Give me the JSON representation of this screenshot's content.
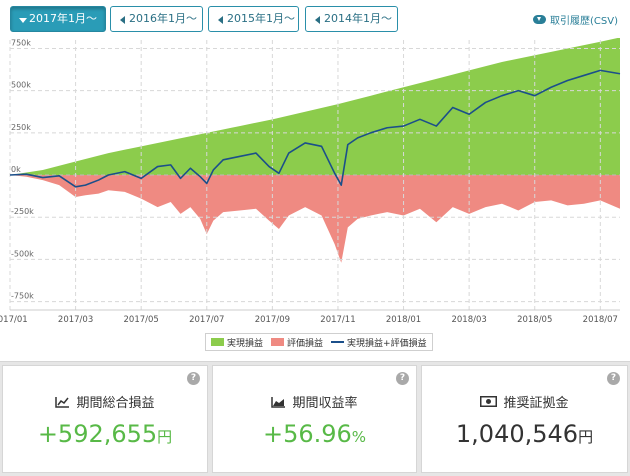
{
  "tabs": [
    {
      "label": "2017年1月～",
      "active": true
    },
    {
      "label": "2016年1月～",
      "active": false
    },
    {
      "label": "2015年1月～",
      "active": false
    },
    {
      "label": "2014年1月～",
      "active": false
    }
  ],
  "csv_link": {
    "label": "取引履歴(CSV)",
    "icon": "cloud-download-icon"
  },
  "chart_data": {
    "type": "area",
    "y_ticks": [
      "750k",
      "500k",
      "250k",
      "0k",
      "-250k",
      "-500k",
      "-750k"
    ],
    "y_tick_values": [
      750,
      500,
      250,
      0,
      -250,
      -500,
      -750
    ],
    "x_ticks": [
      "2017/01",
      "2017/03",
      "2017/05",
      "2017/07",
      "2017/09",
      "2017/11",
      "2018/01",
      "2018/03",
      "2018/05",
      "2018/07"
    ],
    "x_tick_values": [
      0,
      2,
      4,
      6,
      8,
      10,
      12,
      14,
      16,
      18
    ],
    "ylim": [
      -800,
      800
    ],
    "xlim": [
      0,
      18.6
    ],
    "grid": true,
    "legend_position": "bottom-center",
    "colors": {
      "realized": "#8ccc4c",
      "unrealized": "#ef8a82",
      "total": "#1b4f8a"
    },
    "series": [
      {
        "name": "実現損益",
        "kind": "area",
        "x": [
          0,
          1,
          2,
          3,
          4,
          5,
          6,
          7,
          8,
          9,
          10,
          11,
          12,
          13,
          14,
          15,
          16,
          17,
          18,
          18.6
        ],
        "values": [
          0,
          30,
          80,
          130,
          170,
          210,
          250,
          290,
          330,
          375,
          420,
          470,
          520,
          570,
          620,
          670,
          710,
          750,
          790,
          815
        ]
      },
      {
        "name": "評価損益",
        "kind": "area",
        "x": [
          0,
          0.5,
          1,
          1.5,
          2,
          2.3,
          2.7,
          3,
          3.5,
          4,
          4.5,
          4.9,
          5.2,
          5.5,
          5.8,
          6.0,
          6.2,
          6.5,
          7,
          7.5,
          7.9,
          8.2,
          8.5,
          9,
          9.5,
          9.9,
          10.1,
          10.3,
          10.6,
          11,
          11.5,
          12,
          12.5,
          13,
          13.5,
          14,
          14.5,
          15,
          15.5,
          16,
          16.5,
          17,
          17.5,
          18,
          18.6
        ],
        "values": [
          0,
          -10,
          -30,
          -60,
          -130,
          -120,
          -110,
          -90,
          -100,
          -140,
          -190,
          -160,
          -230,
          -190,
          -260,
          -350,
          -270,
          -220,
          -210,
          -200,
          -270,
          -320,
          -240,
          -190,
          -240,
          -410,
          -520,
          -310,
          -260,
          -240,
          -220,
          -240,
          -200,
          -280,
          -190,
          -230,
          -190,
          -170,
          -210,
          -160,
          -150,
          -180,
          -170,
          -150,
          -200
        ]
      },
      {
        "name": "実現損益+評価損益",
        "kind": "line",
        "x": [
          0,
          0.5,
          1,
          1.5,
          2,
          2.3,
          2.7,
          3,
          3.5,
          4,
          4.5,
          4.9,
          5.2,
          5.5,
          5.8,
          6.0,
          6.2,
          6.5,
          7,
          7.5,
          7.9,
          8.2,
          8.5,
          9,
          9.5,
          9.9,
          10.1,
          10.3,
          10.6,
          11,
          11.5,
          12,
          12.5,
          13,
          13.5,
          14,
          14.5,
          15,
          15.5,
          16,
          16.5,
          17,
          17.5,
          18,
          18.6
        ],
        "values": [
          0,
          5,
          -15,
          -5,
          -70,
          -60,
          -30,
          0,
          20,
          -20,
          50,
          60,
          -20,
          40,
          -10,
          -50,
          30,
          90,
          110,
          130,
          50,
          10,
          130,
          190,
          170,
          10,
          -60,
          180,
          220,
          250,
          280,
          290,
          330,
          290,
          400,
          360,
          430,
          470,
          500,
          470,
          520,
          560,
          590,
          620,
          600
        ]
      }
    ]
  },
  "cards": [
    {
      "title": "期間総合損益",
      "icon": "line-chart-icon",
      "value": "+592,655",
      "unit": "円",
      "positive": true
    },
    {
      "title": "期間収益率",
      "icon": "area-chart-icon",
      "value": "+56.96",
      "unit": "%",
      "positive": true
    },
    {
      "title": "推奨証拠金",
      "icon": "money-icon",
      "value": "1,040,546",
      "unit": "円",
      "positive": false
    }
  ],
  "help_label": "?"
}
